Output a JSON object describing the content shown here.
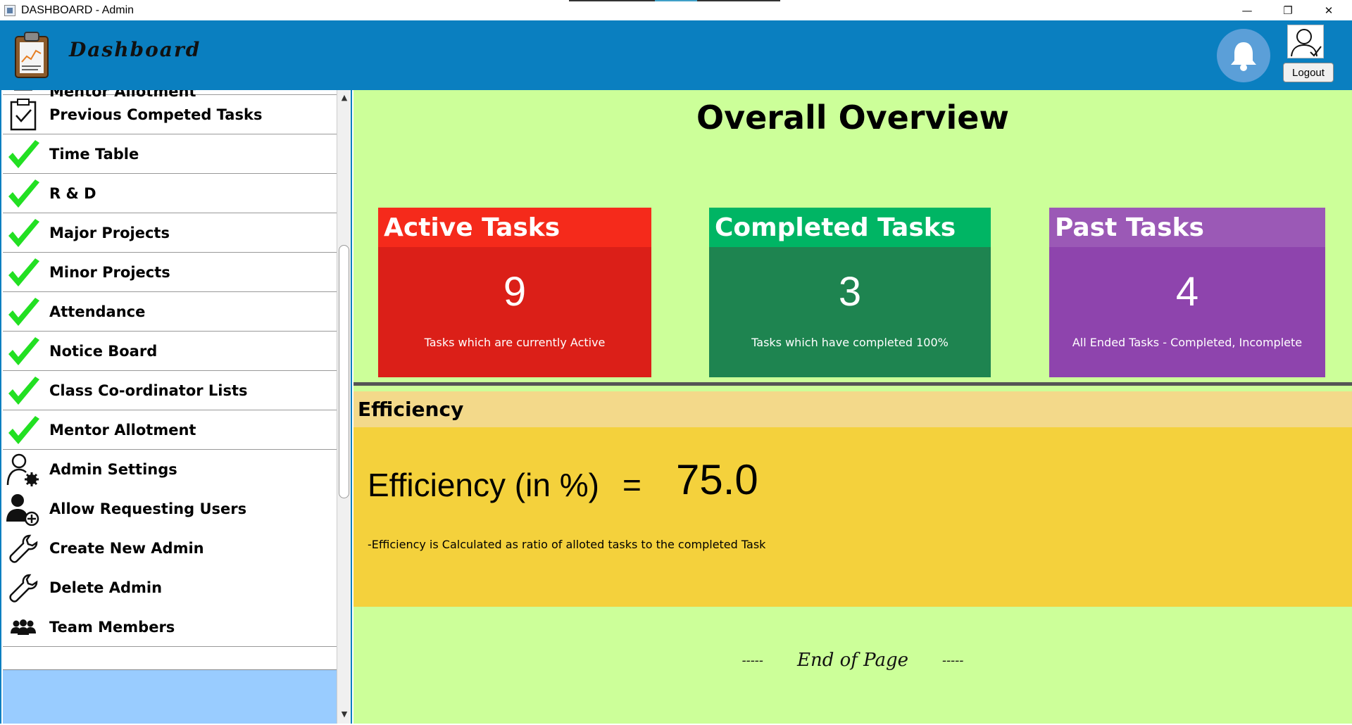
{
  "window": {
    "title": "DASHBOARD - Admin",
    "minimize": "—",
    "restore": "❐",
    "close": "✕"
  },
  "header": {
    "title": "Dashboard",
    "logout_label": "Logout"
  },
  "sidebar": {
    "partial_item": "Mentor Allotment",
    "items": [
      {
        "label": "Previous Competed Tasks",
        "icon": "clipboard-check-icon"
      },
      {
        "label": "Time Table",
        "icon": "green-check-icon"
      },
      {
        "label": "R & D",
        "icon": "green-check-icon"
      },
      {
        "label": "Major Projects",
        "icon": "green-check-icon"
      },
      {
        "label": "Minor Projects",
        "icon": "green-check-icon"
      },
      {
        "label": "Attendance",
        "icon": "green-check-icon"
      },
      {
        "label": "Notice Board",
        "icon": "green-check-icon"
      },
      {
        "label": "Class Co-ordinator Lists",
        "icon": "green-check-icon"
      },
      {
        "label": "Mentor Allotment",
        "icon": "green-check-icon"
      },
      {
        "label": "Admin Settings",
        "icon": "user-gear-icon"
      },
      {
        "label": "Allow Requesting Users",
        "icon": "user-add-icon"
      },
      {
        "label": "Create New Admin",
        "icon": "wrench-icon"
      },
      {
        "label": "Delete Admin",
        "icon": "wrench-icon"
      },
      {
        "label": "Team Members",
        "icon": "team-icon"
      }
    ]
  },
  "main": {
    "title": "Overall Overview",
    "cards": [
      {
        "title": "Active Tasks",
        "value": "9",
        "desc": "Tasks which are currently Active",
        "head_color": "#f52a1b",
        "body_color": "#db1f18"
      },
      {
        "title": "Completed Tasks",
        "value": "3",
        "desc": "Tasks which have completed 100%",
        "head_color": "#00b564",
        "body_color": "#1e8450"
      },
      {
        "title": "Past Tasks",
        "value": "4",
        "desc": "All Ended Tasks - Completed, Incomplete",
        "head_color": "#9b59b6",
        "body_color": "#8e44ad"
      }
    ],
    "efficiency": {
      "heading": "Efficiency",
      "label": "Efficiency (in %)",
      "equals": "=",
      "value": "75.0",
      "note": "-Efficiency is Calculated as ratio of alloted tasks to the completed Task"
    },
    "end": {
      "dash": "-----",
      "text": "End of Page"
    }
  }
}
